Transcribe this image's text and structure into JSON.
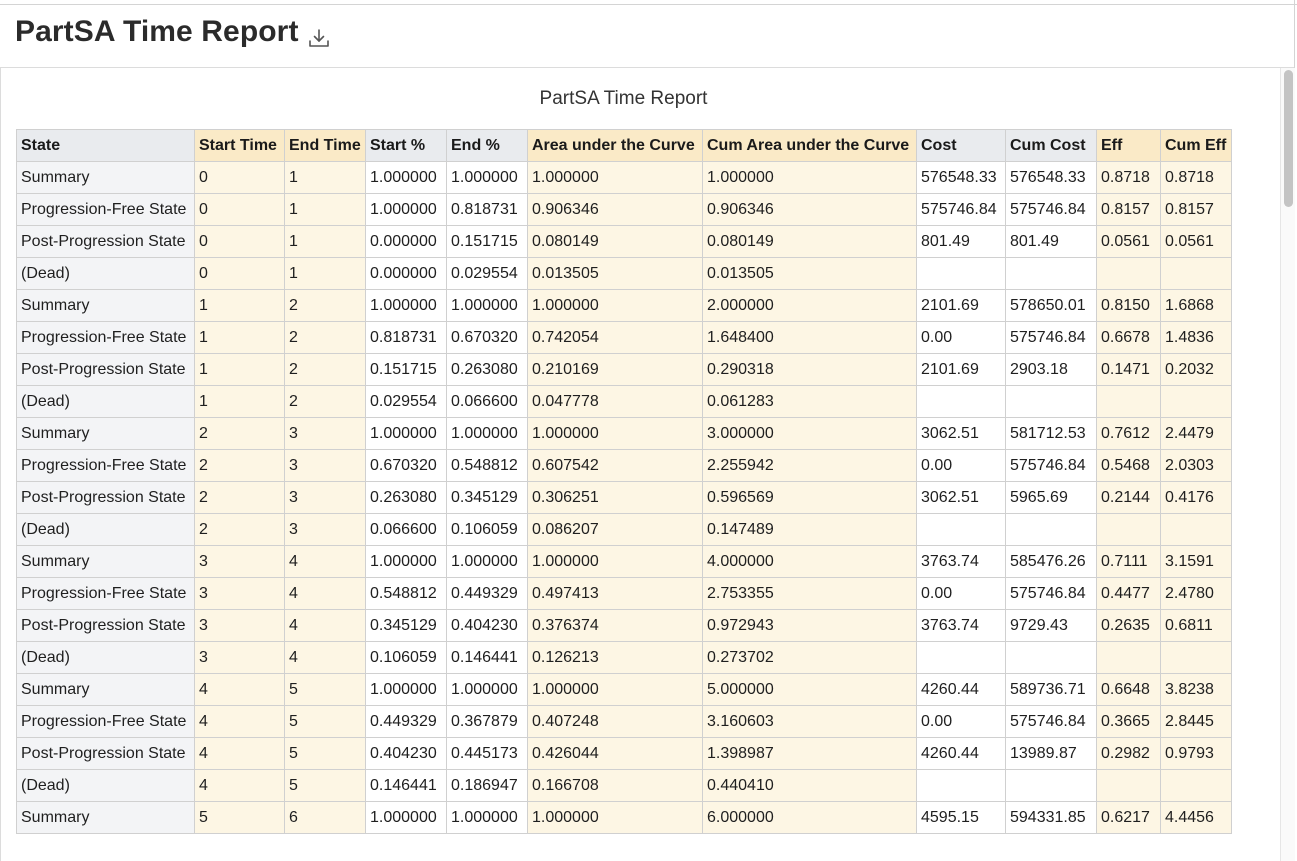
{
  "page": {
    "title": "PartSA Time Report",
    "download_icon": "download-icon"
  },
  "report": {
    "title": "PartSA Time Report",
    "columns": [
      "State",
      "Start Time",
      "End Time",
      "Start %",
      "End %",
      "Area under the Curve",
      "Cum Area under the Curve",
      "Cost",
      "Cum Cost",
      "Eff",
      "Cum Eff"
    ],
    "rows": [
      [
        "Summary",
        "0",
        "1",
        "1.000000",
        "1.000000",
        "1.000000",
        "1.000000",
        "576548.33",
        "576548.33",
        "0.8718",
        "0.8718"
      ],
      [
        "Progression-Free State",
        "0",
        "1",
        "1.000000",
        "0.818731",
        "0.906346",
        "0.906346",
        "575746.84",
        "575746.84",
        "0.8157",
        "0.8157"
      ],
      [
        "Post-Progression State",
        "0",
        "1",
        "0.000000",
        "0.151715",
        "0.080149",
        "0.080149",
        "801.49",
        "801.49",
        "0.0561",
        "0.0561"
      ],
      [
        "(Dead)",
        "0",
        "1",
        "0.000000",
        "0.029554",
        "0.013505",
        "0.013505",
        "",
        "",
        "",
        ""
      ],
      [
        "Summary",
        "1",
        "2",
        "1.000000",
        "1.000000",
        "1.000000",
        "2.000000",
        "2101.69",
        "578650.01",
        "0.8150",
        "1.6868"
      ],
      [
        "Progression-Free State",
        "1",
        "2",
        "0.818731",
        "0.670320",
        "0.742054",
        "1.648400",
        "0.00",
        "575746.84",
        "0.6678",
        "1.4836"
      ],
      [
        "Post-Progression State",
        "1",
        "2",
        "0.151715",
        "0.263080",
        "0.210169",
        "0.290318",
        "2101.69",
        "2903.18",
        "0.1471",
        "0.2032"
      ],
      [
        "(Dead)",
        "1",
        "2",
        "0.029554",
        "0.066600",
        "0.047778",
        "0.061283",
        "",
        "",
        "",
        ""
      ],
      [
        "Summary",
        "2",
        "3",
        "1.000000",
        "1.000000",
        "1.000000",
        "3.000000",
        "3062.51",
        "581712.53",
        "0.7612",
        "2.4479"
      ],
      [
        "Progression-Free State",
        "2",
        "3",
        "0.670320",
        "0.548812",
        "0.607542",
        "2.255942",
        "0.00",
        "575746.84",
        "0.5468",
        "2.0303"
      ],
      [
        "Post-Progression State",
        "2",
        "3",
        "0.263080",
        "0.345129",
        "0.306251",
        "0.596569",
        "3062.51",
        "5965.69",
        "0.2144",
        "0.4176"
      ],
      [
        "(Dead)",
        "2",
        "3",
        "0.066600",
        "0.106059",
        "0.086207",
        "0.147489",
        "",
        "",
        "",
        ""
      ],
      [
        "Summary",
        "3",
        "4",
        "1.000000",
        "1.000000",
        "1.000000",
        "4.000000",
        "3763.74",
        "585476.26",
        "0.7111",
        "3.1591"
      ],
      [
        "Progression-Free State",
        "3",
        "4",
        "0.548812",
        "0.449329",
        "0.497413",
        "2.753355",
        "0.00",
        "575746.84",
        "0.4477",
        "2.4780"
      ],
      [
        "Post-Progression State",
        "3",
        "4",
        "0.345129",
        "0.404230",
        "0.376374",
        "0.972943",
        "3763.74",
        "9729.43",
        "0.2635",
        "0.6811"
      ],
      [
        "(Dead)",
        "3",
        "4",
        "0.106059",
        "0.146441",
        "0.126213",
        "0.273702",
        "",
        "",
        "",
        ""
      ],
      [
        "Summary",
        "4",
        "5",
        "1.000000",
        "1.000000",
        "1.000000",
        "5.000000",
        "4260.44",
        "589736.71",
        "0.6648",
        "3.8238"
      ],
      [
        "Progression-Free State",
        "4",
        "5",
        "0.449329",
        "0.367879",
        "0.407248",
        "3.160603",
        "0.00",
        "575746.84",
        "0.3665",
        "2.8445"
      ],
      [
        "Post-Progression State",
        "4",
        "5",
        "0.404230",
        "0.445173",
        "0.426044",
        "1.398987",
        "4260.44",
        "13989.87",
        "0.2982",
        "0.9793"
      ],
      [
        "(Dead)",
        "4",
        "5",
        "0.146441",
        "0.186947",
        "0.166708",
        "0.440410",
        "",
        "",
        "",
        ""
      ],
      [
        "Summary",
        "5",
        "6",
        "1.000000",
        "1.000000",
        "1.000000",
        "6.000000",
        "4595.15",
        "594331.85",
        "0.6217",
        "4.4456"
      ]
    ]
  },
  "colors": {
    "header_gray": "#e9ebee",
    "header_yellow": "#faeac7",
    "cell_yellow": "#fdf6e4",
    "cell_gray": "#f3f4f6"
  }
}
